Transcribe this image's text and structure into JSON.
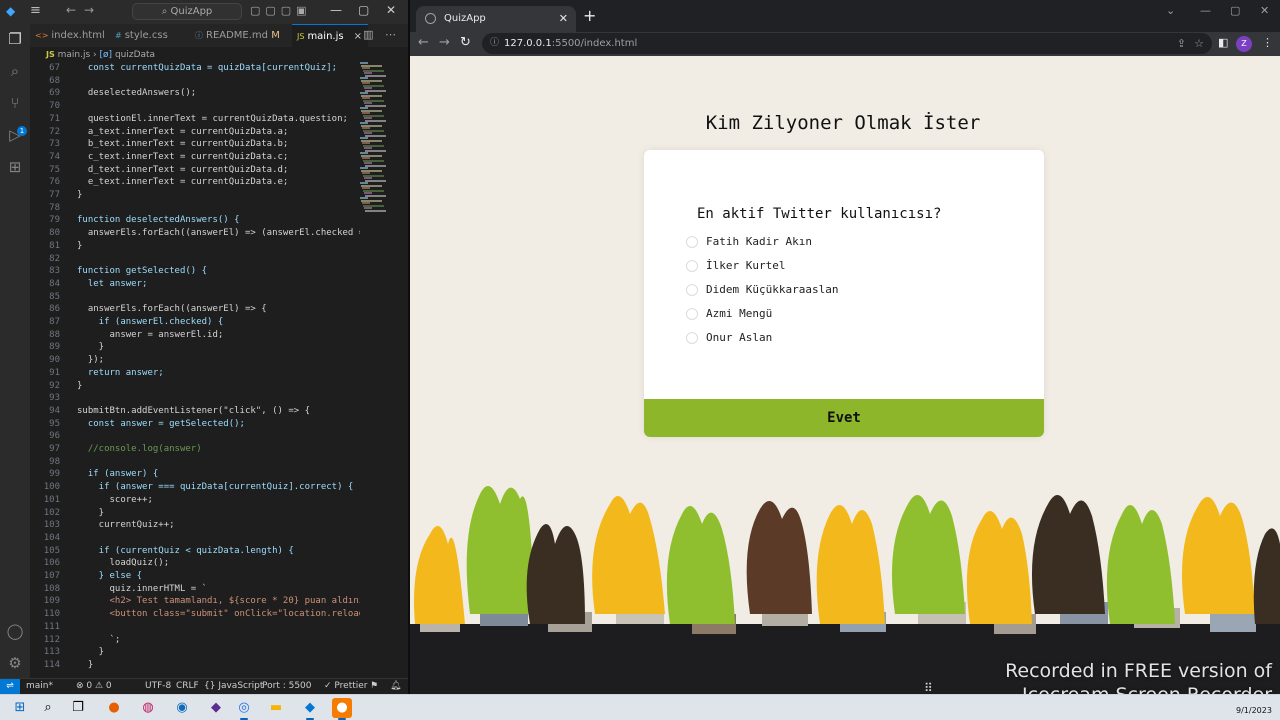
{
  "vscode": {
    "search_placeholder": "QuizApp",
    "tabs": [
      {
        "label": "index.html",
        "icon": "<>",
        "color": "#e37933"
      },
      {
        "label": "style.css",
        "icon": "#",
        "color": "#519aba"
      },
      {
        "label": "README.md",
        "icon": "i",
        "color": "#519aba",
        "status": "M"
      },
      {
        "label": "main.js",
        "icon": "JS",
        "color": "#cbcb41",
        "close": "×"
      }
    ],
    "breadcrumb": {
      "file": "main.js",
      "sep": "›",
      "symbol": "quizData"
    },
    "code_lines": [
      {
        "n": "67",
        "t": "  const currentQuizData = quizData[currentQuiz];"
      },
      {
        "n": "68",
        "t": ""
      },
      {
        "n": "69",
        "t": "  deselectedAnswers();"
      },
      {
        "n": "70",
        "t": ""
      },
      {
        "n": "71",
        "t": "  questionEl.innerText = currentQuizData.question;"
      },
      {
        "n": "72",
        "t": "  a_text.innerText = currentQuizData.a;"
      },
      {
        "n": "73",
        "t": "  b_text.innerText = currentQuizData.b;"
      },
      {
        "n": "74",
        "t": "  c_text.innerText = currentQuizData.c;"
      },
      {
        "n": "75",
        "t": "  d_text.innerText = currentQuizData.d;"
      },
      {
        "n": "76",
        "t": "  e_text.innerText = currentQuizData.e;"
      },
      {
        "n": "77",
        "t": "}"
      },
      {
        "n": "78",
        "t": ""
      },
      {
        "n": "79",
        "t": "function deselectedAnswers() {"
      },
      {
        "n": "80",
        "t": "  answerEls.forEach((answerEl) => (answerEl.checked = f"
      },
      {
        "n": "81",
        "t": "}"
      },
      {
        "n": "82",
        "t": ""
      },
      {
        "n": "83",
        "t": "function getSelected() {"
      },
      {
        "n": "84",
        "t": "  let answer;"
      },
      {
        "n": "85",
        "t": ""
      },
      {
        "n": "86",
        "t": "  answerEls.forEach((answerEl) => {"
      },
      {
        "n": "87",
        "t": "    if (answerEl.checked) {"
      },
      {
        "n": "88",
        "t": "      answer = answerEl.id;"
      },
      {
        "n": "89",
        "t": "    }"
      },
      {
        "n": "90",
        "t": "  });"
      },
      {
        "n": "91",
        "t": "  return answer;"
      },
      {
        "n": "92",
        "t": "}"
      },
      {
        "n": "93",
        "t": ""
      },
      {
        "n": "94",
        "t": "submitBtn.addEventListener(\"click\", () => {"
      },
      {
        "n": "95",
        "t": "  const answer = getSelected();"
      },
      {
        "n": "96",
        "t": ""
      },
      {
        "n": "97",
        "t": "  //console.log(answer)"
      },
      {
        "n": "98",
        "t": ""
      },
      {
        "n": "99",
        "t": "  if (answer) {"
      },
      {
        "n": "100",
        "t": "    if (answer === quizData[currentQuiz].correct) {"
      },
      {
        "n": "101",
        "t": "      score++;"
      },
      {
        "n": "102",
        "t": "    }"
      },
      {
        "n": "103",
        "t": "    currentQuiz++;"
      },
      {
        "n": "104",
        "t": ""
      },
      {
        "n": "105",
        "t": "    if (currentQuiz < quizData.length) {"
      },
      {
        "n": "106",
        "t": "      loadQuiz();"
      },
      {
        "n": "107",
        "t": "    } else {"
      },
      {
        "n": "108",
        "t": "      quiz.innerHTML = `"
      },
      {
        "n": "109",
        "t": "      <h2> Test tamamlandı, ${score * 20} puan aldınız"
      },
      {
        "n": "110",
        "t": "      <button class=\"submit\" onClick=\"location.reload("
      },
      {
        "n": "111",
        "t": ""
      },
      {
        "n": "112",
        "t": "      `;"
      },
      {
        "n": "113",
        "t": "    }"
      },
      {
        "n": "114",
        "t": "  }"
      }
    ],
    "status": {
      "branch": "main*",
      "problems": "⊗ 0 ⚠ 0",
      "ports": "0",
      "encoding": "UTF-8",
      "eol": "CRLF",
      "language": "{} JavaScript",
      "port": "Port : 5500",
      "prettier": "✓ Prettier"
    }
  },
  "browser": {
    "tab_title": "QuizApp",
    "url_host": "127.0.0.1",
    "url_path": ":5500/index.html",
    "profile_initial": "Z"
  },
  "quiz": {
    "title": "Kim Zilyoner Olmak İster",
    "question": "En aktif Twitter kullanıcısı?",
    "answers": [
      "Fatih Kadir Akın",
      "İlker Kurtel",
      "Didem Küçükkaraaslan",
      "Azmi Mengü",
      "Onur Aslan"
    ],
    "submit_label": "Evet",
    "accent_color": "#8db62a"
  },
  "watermark": {
    "line1": "Recorded in FREE version of",
    "line2": "Icecream  Screen  Recorder"
  },
  "taskbar": {
    "date": "9/1/2023"
  }
}
